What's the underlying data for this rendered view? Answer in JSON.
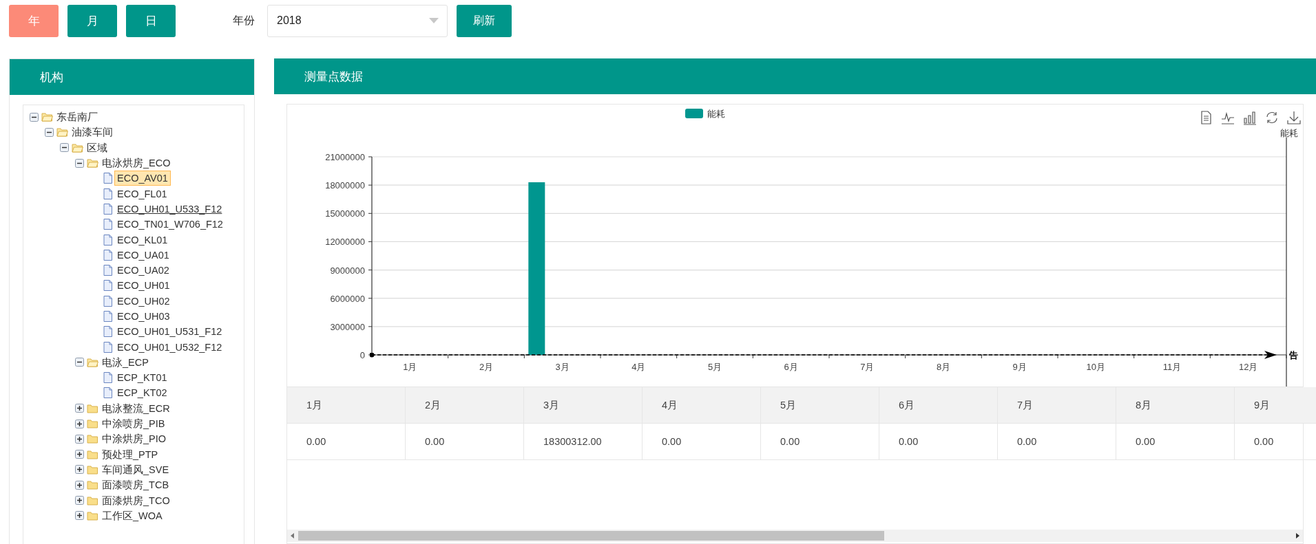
{
  "mode_tabs": [
    {
      "label": "年",
      "selected": true
    },
    {
      "label": "月",
      "selected": false
    },
    {
      "label": "日",
      "selected": false
    }
  ],
  "year_filter": {
    "label": "年份",
    "value": "2018"
  },
  "refresh_button": "刷新",
  "org_panel": {
    "title": "机构",
    "tree": [
      {
        "label": "东岳南厂",
        "kind": "folder",
        "expanded": true,
        "selected": false,
        "hovered": false,
        "children": [
          {
            "label": "油漆车间",
            "kind": "folder",
            "expanded": true,
            "selected": false,
            "hovered": false,
            "children": [
              {
                "label": "区域",
                "kind": "folder",
                "expanded": true,
                "selected": false,
                "hovered": false,
                "children": [
                  {
                    "label": "电泳烘房_ECO",
                    "kind": "folder",
                    "expanded": true,
                    "selected": false,
                    "hovered": false,
                    "children": [
                      {
                        "label": "ECO_AV01",
                        "kind": "file",
                        "selected": true,
                        "hovered": false
                      },
                      {
                        "label": "ECO_FL01",
                        "kind": "file",
                        "selected": false,
                        "hovered": false
                      },
                      {
                        "label": "ECO_UH01_U533_F12",
                        "kind": "file",
                        "selected": false,
                        "hovered": true
                      },
                      {
                        "label": "ECO_TN01_W706_F12",
                        "kind": "file",
                        "selected": false,
                        "hovered": false
                      },
                      {
                        "label": "ECO_KL01",
                        "kind": "file",
                        "selected": false,
                        "hovered": false
                      },
                      {
                        "label": "ECO_UA01",
                        "kind": "file",
                        "selected": false,
                        "hovered": false
                      },
                      {
                        "label": "ECO_UA02",
                        "kind": "file",
                        "selected": false,
                        "hovered": false
                      },
                      {
                        "label": "ECO_UH01",
                        "kind": "file",
                        "selected": false,
                        "hovered": false
                      },
                      {
                        "label": "ECO_UH02",
                        "kind": "file",
                        "selected": false,
                        "hovered": false
                      },
                      {
                        "label": "ECO_UH03",
                        "kind": "file",
                        "selected": false,
                        "hovered": false
                      },
                      {
                        "label": "ECO_UH01_U531_F12",
                        "kind": "file",
                        "selected": false,
                        "hovered": false
                      },
                      {
                        "label": "ECO_UH01_U532_F12",
                        "kind": "file",
                        "selected": false,
                        "hovered": false
                      }
                    ]
                  },
                  {
                    "label": "电泳_ECP",
                    "kind": "folder",
                    "expanded": true,
                    "selected": false,
                    "hovered": false,
                    "children": [
                      {
                        "label": "ECP_KT01",
                        "kind": "file",
                        "selected": false,
                        "hovered": false
                      },
                      {
                        "label": "ECP_KT02",
                        "kind": "file",
                        "selected": false,
                        "hovered": false
                      }
                    ]
                  },
                  {
                    "label": "电泳整流_ECR",
                    "kind": "folder",
                    "expanded": false,
                    "selected": false,
                    "hovered": false
                  },
                  {
                    "label": "中涂喷房_PIB",
                    "kind": "folder",
                    "expanded": false,
                    "selected": false,
                    "hovered": false
                  },
                  {
                    "label": "中涂烘房_PIO",
                    "kind": "folder",
                    "expanded": false,
                    "selected": false,
                    "hovered": false
                  },
                  {
                    "label": "预处理_PTP",
                    "kind": "folder",
                    "expanded": false,
                    "selected": false,
                    "hovered": false
                  },
                  {
                    "label": "车间通风_SVE",
                    "kind": "folder",
                    "expanded": false,
                    "selected": false,
                    "hovered": false
                  },
                  {
                    "label": "面漆喷房_TCB",
                    "kind": "folder",
                    "expanded": false,
                    "selected": false,
                    "hovered": false
                  },
                  {
                    "label": "面漆烘房_TCO",
                    "kind": "folder",
                    "expanded": false,
                    "selected": false,
                    "hovered": false
                  },
                  {
                    "label": "工作区_WOA",
                    "kind": "folder",
                    "expanded": false,
                    "selected": false,
                    "hovered": false
                  }
                ]
              }
            ]
          }
        ]
      }
    ]
  },
  "data_panel": {
    "title": "测量点数据",
    "right_axis_name": "能耗",
    "chart_data": {
      "type": "bar",
      "categories": [
        "1月",
        "2月",
        "3月",
        "4月",
        "5月",
        "6月",
        "7月",
        "8月",
        "9月",
        "10月",
        "11月",
        "12月"
      ],
      "series": [
        {
          "name": "能耗",
          "color": "#00968f",
          "values": [
            0,
            0,
            18300000,
            0,
            0,
            0,
            0,
            0,
            0,
            0,
            0,
            0
          ]
        }
      ],
      "grid": true,
      "ref_lines": [
        {
          "axis": "y",
          "value": 0,
          "label": "告"
        }
      ],
      "ylim": [
        0,
        21000000
      ],
      "yticks": [
        0,
        3000000,
        6000000,
        9000000,
        12000000,
        15000000,
        18000000,
        21000000
      ]
    },
    "table": {
      "columns": [
        "1月",
        "2月",
        "3月",
        "4月",
        "5月",
        "6月",
        "7月",
        "8月",
        "9月"
      ],
      "rows": [
        [
          "0.00",
          "0.00",
          "18300312.00",
          "0.00",
          "0.00",
          "0.00",
          "0.00",
          "0.00",
          "0.00"
        ]
      ]
    }
  }
}
